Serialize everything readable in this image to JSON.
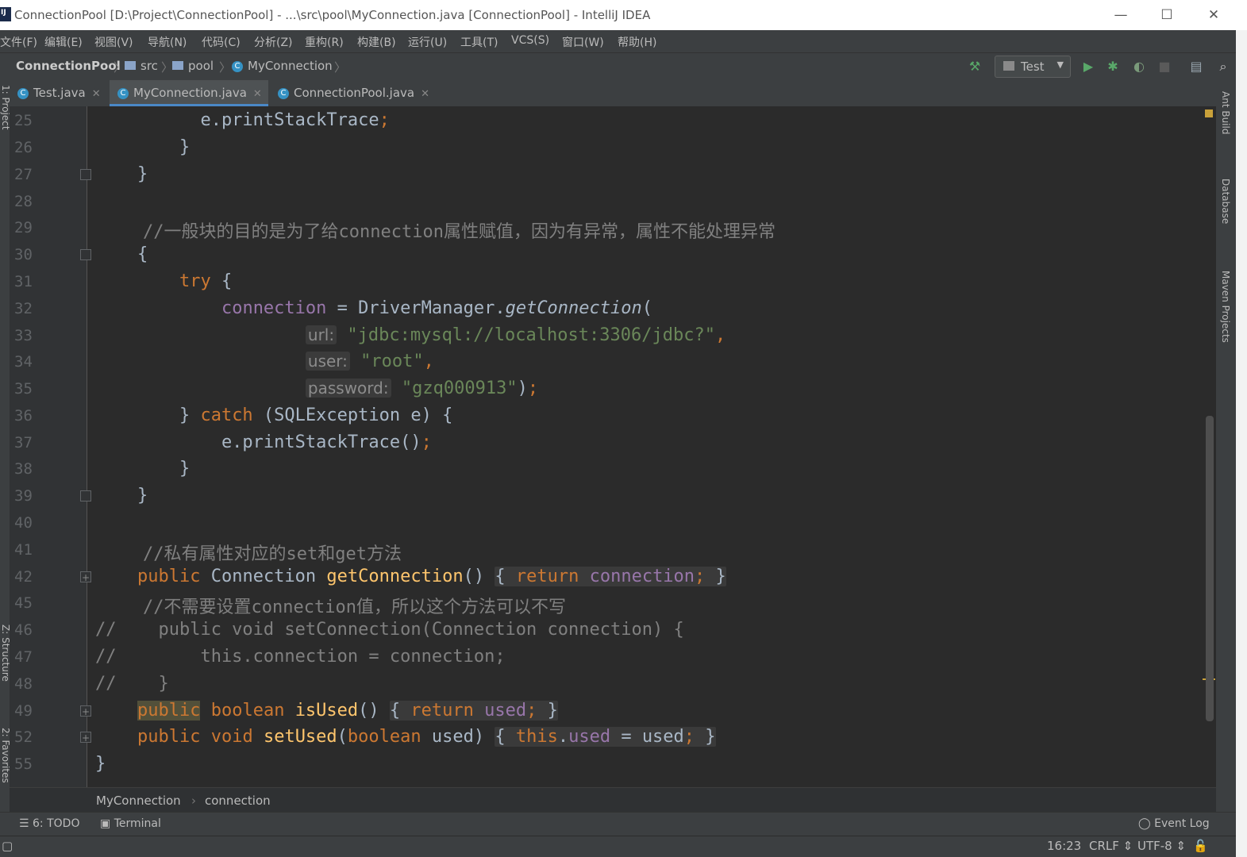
{
  "window": {
    "title": "ConnectionPool [D:\\Project\\ConnectionPool] - ...\\src\\pool\\MyConnection.java [ConnectionPool] - IntelliJ IDEA",
    "minimize": "—",
    "maximize": "☐",
    "close": "✕"
  },
  "menu": [
    "文件(F)",
    "编辑(E)",
    "视图(V)",
    "导航(N)",
    "代码(C)",
    "分析(Z)",
    "重构(R)",
    "构建(B)",
    "运行(U)",
    "工具(T)",
    "VCS(S)",
    "窗口(W)",
    "帮助(H)"
  ],
  "nav": {
    "project": "ConnectionPool",
    "src": "src",
    "pool": "pool",
    "file": "MyConnection",
    "run_config": "Test"
  },
  "tabs": [
    {
      "label": "Test.java",
      "icon": "class-icon"
    },
    {
      "label": "MyConnection.java",
      "icon": "class-icon",
      "active": true
    },
    {
      "label": "ConnectionPool.java",
      "icon": "class-icon"
    }
  ],
  "side": {
    "ant": "Ant Build",
    "database": "Database",
    "maven": "Maven Projects",
    "project": "1: Project",
    "structure": "Z: Structure",
    "favorites": "2: Favorites"
  },
  "editor": {
    "lines": [
      {
        "n": "25",
        "text": "e.printStackTrace();"
      },
      {
        "n": "26",
        "text": "}"
      },
      {
        "n": "27",
        "text": "}"
      },
      {
        "n": "28",
        "text": ""
      },
      {
        "n": "29",
        "text": "//一般块的目的是为了给connection属性赋值，因为有异常，属性不能处理异常"
      },
      {
        "n": "30",
        "text": "{"
      },
      {
        "n": "31",
        "text": "try {"
      },
      {
        "n": "32",
        "text": "connection = DriverManager.getConnection("
      },
      {
        "n": "33",
        "text": "url: \"jdbc:mysql://localhost:3306/jdbc?\","
      },
      {
        "n": "34",
        "text": "user: \"root\","
      },
      {
        "n": "35",
        "text": "password: \"gzq000913\");"
      },
      {
        "n": "36",
        "text": "} catch (SQLException e) {"
      },
      {
        "n": "37",
        "text": "e.printStackTrace();"
      },
      {
        "n": "38",
        "text": "}"
      },
      {
        "n": "39",
        "text": "}"
      },
      {
        "n": "40",
        "text": ""
      },
      {
        "n": "41",
        "text": "//私有属性对应的set和get方法"
      },
      {
        "n": "42",
        "text": "public Connection getConnection() { return connection; }"
      },
      {
        "n": "45",
        "text": "//不需要设置connection值，所以这个方法可以不写"
      },
      {
        "n": "46",
        "text": "//    public void setConnection(Connection connection) {"
      },
      {
        "n": "47",
        "text": "//        this.connection = connection;"
      },
      {
        "n": "48",
        "text": "//    }"
      },
      {
        "n": "49",
        "text": "public boolean isUsed() { return used; }"
      },
      {
        "n": "52",
        "text": "public void setUsed(boolean used) { this.used = used; }"
      },
      {
        "n": "55",
        "text": "}"
      }
    ]
  },
  "breadcrumb": {
    "class": "MyConnection",
    "member": "connection"
  },
  "toolwindows": {
    "todo": "6: TODO",
    "terminal": "Terminal",
    "eventlog": "Event Log"
  },
  "status": {
    "position": "16:23",
    "line_sep": "CRLF",
    "encoding": "UTF-8"
  },
  "colors": {
    "keyword": "#cc7832",
    "string": "#6a8759",
    "comment": "#808080",
    "field": "#9876aa",
    "method": "#ffc66d",
    "accent": "#4a88c7"
  }
}
